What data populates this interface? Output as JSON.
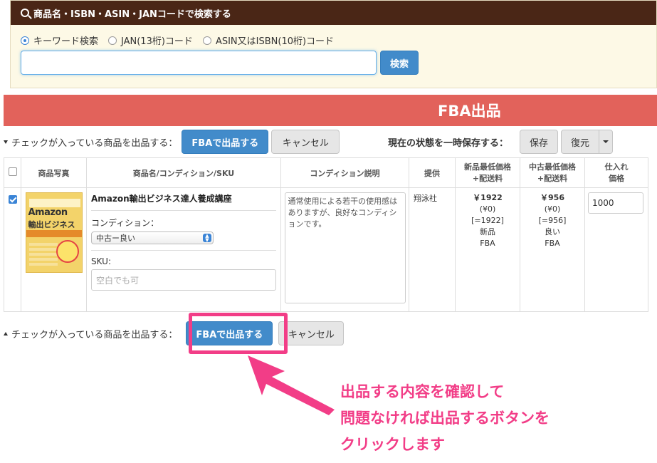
{
  "search": {
    "title": "商品名・ISBN・ASIN・JANコードで検索する",
    "options": [
      {
        "label": "キーワード検索",
        "selected": true
      },
      {
        "label": "JAN(13桁)コード",
        "selected": false
      },
      {
        "label": "ASIN又はISBN(10桁)コード",
        "selected": false
      }
    ],
    "input_value": "",
    "button_label": "検索"
  },
  "banner": {
    "title": "FBA出品"
  },
  "toolbar_top": {
    "label": "チェックが入っている商品を出品する：",
    "submit_label": "FBAで出品する",
    "cancel_label": "キャンセル",
    "save_state_label": "現在の状態を一時保存する：",
    "save_label": "保存",
    "restore_label": "復元"
  },
  "table": {
    "headers": {
      "photo": "商品写真",
      "name": "商品名/コンディション/SKU",
      "desc": "コンディション説明",
      "provider": "提供",
      "new_price_1": "新品最低価格",
      "new_price_2": "+配送料",
      "used_price_1": "中古最低価格",
      "used_price_2": "+配送料",
      "cost_1": "仕入れ",
      "cost_2": "価格"
    },
    "row": {
      "checked": true,
      "book_cover": {
        "title": "Amazon",
        "subtitle": "輸出ビジネス"
      },
      "name": "Amazon輸出ビジネス達人養成講座",
      "condition_label": "コンディション：",
      "condition_value": "中古ー良い",
      "sku_label": "SKU:",
      "sku_placeholder": "空白でも可",
      "description": "通常使用による若干の使用感はありますが、良好なコンディションです。",
      "provider": "翔泳社",
      "new_price": {
        "main": "￥1922",
        "shipping": "(¥0)",
        "total": "[=1922]",
        "condition": "新品",
        "channel": "FBA"
      },
      "used_price": {
        "main": "￥956",
        "shipping": "(¥0)",
        "total": "[=956]",
        "condition": "良い",
        "channel": "FBA"
      },
      "cost": "1000"
    }
  },
  "toolbar_bottom": {
    "label": "チェックが入っている商品を出品する：",
    "submit_label": "FBAで出品する",
    "cancel_label": "キャンセル"
  },
  "annotation": {
    "lines": [
      "出品する内容を確認して",
      "問題なければ出品するボタンを",
      "クリックします"
    ],
    "color": "#f23d87"
  },
  "colors": {
    "banner": "#e2625b",
    "header_bar": "#4a2616",
    "primary": "#428bca"
  }
}
